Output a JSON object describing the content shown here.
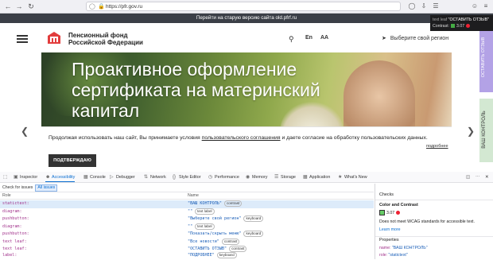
{
  "browser": {
    "back_icon": "arrow-left-icon",
    "forward_icon": "arrow-right-icon",
    "reload_icon": "reload-icon",
    "url": "https://pfr.gov.ru"
  },
  "tooltip": {
    "role_label": "text leaf",
    "role_value": "\"ОСТАВИТЬ ОТЗЫВ\"",
    "contrast_label": "Contrast:",
    "contrast_value": "3.07"
  },
  "old_version_bar": "Перейти на старую версию сайта old.pfrf.ru",
  "header": {
    "brand_line1": "Пенсионный фонд",
    "brand_line2": "Российской Федерации",
    "lang": "En",
    "font_size": "AA",
    "region": "Выберите свой регион"
  },
  "side_buttons": {
    "feedback": "ОСТАВИТЬ ОТЗЫВ",
    "contacts": "ВАШ КОНТРОЛЬ"
  },
  "hero": {
    "title": "Проактивное оформление сертификата на материнский капитал"
  },
  "consent": {
    "text_before": "Продолжая использовать наш сайт, Вы принимаете условия ",
    "link": "пользовательского соглашения",
    "text_after": " и даете согласие на обработку пользовательских данных.",
    "more": "подробнее",
    "ok_button": "ПОДТВЕРЖДАЮ"
  },
  "devtools": {
    "tabs": [
      "Inspector",
      "Accessibility",
      "Console",
      "Debugger",
      "Network",
      "Style Editor",
      "Performance",
      "Memory",
      "Storage",
      "Application",
      "What's New"
    ],
    "check_label": "Check for issues",
    "check_value": "All issues",
    "col_role": "Role",
    "col_name": "Name",
    "rows": [
      {
        "role": "statictext:",
        "name": "\"ВАШ КОНТРОЛЬ\"",
        "badge": "contrast"
      },
      {
        "role": "diagram:",
        "name": "\"\"",
        "badge": "text label"
      },
      {
        "role": "pushbutton:",
        "name": "\"Выберите свой регион\"",
        "badge": "keyboard"
      },
      {
        "role": "diagram:",
        "name": "\"\"",
        "badge": "text label"
      },
      {
        "role": "pushbutton:",
        "name": "\"Показать/скрыть меню\"",
        "badge": "keyboard"
      },
      {
        "role": "text leaf:",
        "name": "\"Все новости\"",
        "badge": "contrast"
      },
      {
        "role": "text leaf:",
        "name": "\"ОСТАВИТЬ ОТЗЫВ\"",
        "badge": "contrast"
      },
      {
        "role": "label:",
        "name": "\"ПОДРОБНЕЕ\"",
        "badge": "keyboard"
      }
    ],
    "checks": {
      "header": "Checks",
      "section": "Color and Contrast",
      "contrast_value": "3.07",
      "description": "Does not meet WCAG standards for accessible text.",
      "learn_more": "Learn more",
      "properties_header": "Properties",
      "prop_name_key": "name:",
      "prop_name_val": "\"ВАШ КОНТРОЛЬ\"",
      "prop_role_key": "role:",
      "prop_role_val": "\"statictext\""
    }
  },
  "colors": {
    "accent": "#0a6ed1",
    "feedback_button": "#b3a2e6",
    "contacts_button": "#d3e8d2"
  }
}
